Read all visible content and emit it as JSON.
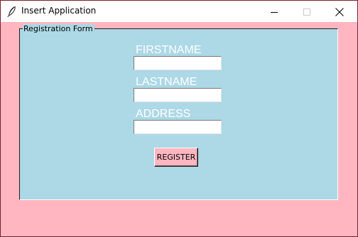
{
  "window": {
    "title": "Insert Application",
    "controls": {
      "minimize": "minimize",
      "maximize": "maximize",
      "close": "close"
    }
  },
  "form": {
    "legend": "Registration Form",
    "fields": [
      {
        "label": "FIRSTNAME",
        "value": ""
      },
      {
        "label": "LASTNAME",
        "value": ""
      },
      {
        "label": "ADDRESS",
        "value": ""
      }
    ],
    "submit_label": "REGISTER"
  },
  "colors": {
    "window_background": "#ffb6c1",
    "form_background": "#add8e6",
    "label_color": "#ffffff",
    "button_background": "#ffb6c1"
  },
  "icons": {
    "app": "feather-icon",
    "minimize": "minimize-icon",
    "maximize": "maximize-icon",
    "close": "close-icon"
  }
}
